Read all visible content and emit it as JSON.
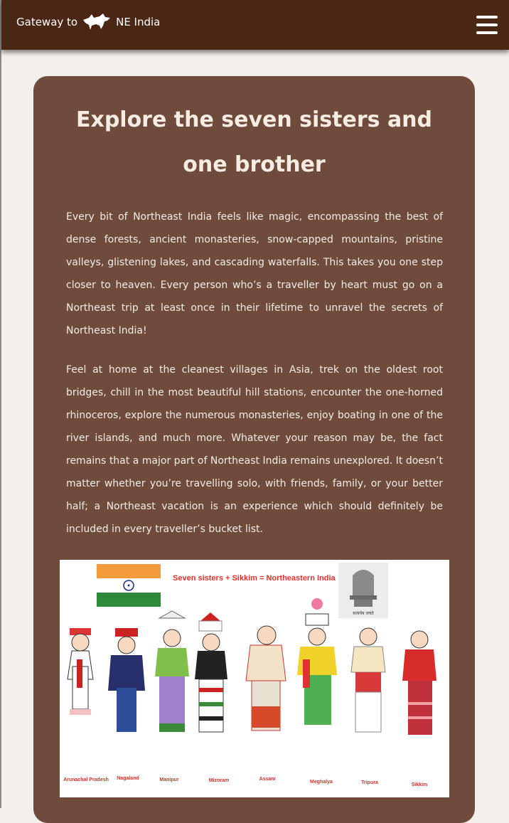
{
  "header": {
    "logo_text_left": "Gateway to",
    "logo_text_right": "NE India",
    "logo_icon": "rhino-icon",
    "menu_icon": "hamburger-menu-icon"
  },
  "main": {
    "title": "Explore the seven sisters and one brother",
    "paragraphs": [
      "Every bit of Northeast India feels like magic, encompassing the best of dense forests, ancient monasteries, snow-capped mountains, pristine valleys, glistening lakes, and cascading waterfalls. This takes you one step closer to heaven. Every person who’s a traveller by heart must go on a Northeast trip at least once in their lifetime to unravel the secrets of Northeast India!",
      "Feel at home at the cleanest villages in Asia, trek on the oldest root bridges, chill in the most beautiful hill stations, encounter the one-horned rhinoceros, explore the numerous monasteries, enjoy boating in one of the river islands, and much more. Whatever your reason may be, the fact remains that a major part of Northeast India remains unexplored. It doesn’t matter whether you’re travelling solo, with friends, family, or your better half; a Northeast vacation is an experience which should definitely be included in every traveller’s bucket list."
    ]
  },
  "illustration": {
    "heading": "Seven sisters + Sikkim = Northeastern India",
    "emblem_caption": "सत्यमेव जयते",
    "states": [
      "Arunachal Pradesh",
      "Nagaland",
      "Manipur",
      "Mizoram",
      "Assam",
      "Meghalya",
      "Tripura",
      "Sikkim"
    ],
    "colors": {
      "header_bg": "#4a2614",
      "card_bg": "#6f4b3b",
      "page_bg": "#f3efea",
      "heading_red": "#e0312b",
      "flag_saffron": "#f39a3a",
      "flag_green": "#2e8a3a"
    }
  }
}
